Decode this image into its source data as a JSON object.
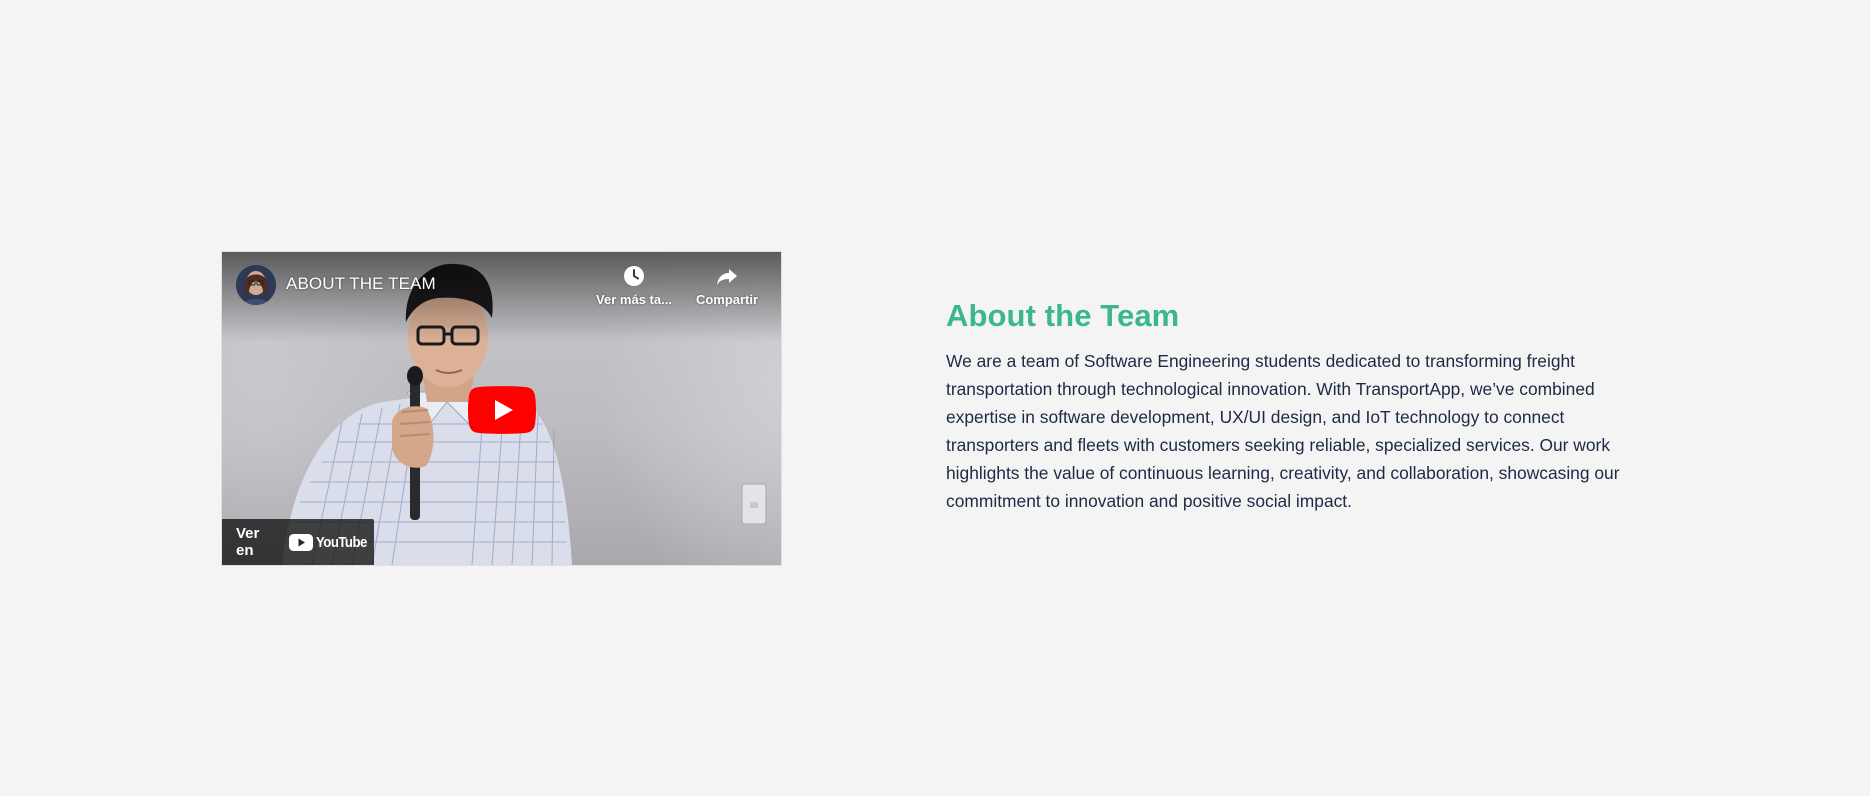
{
  "video": {
    "title": "ABOUT THE TEAM",
    "watch_later_label": "Ver más ta...",
    "share_label": "Compartir",
    "watch_on_label": "Ver en",
    "youtube_wordmark": "YouTube",
    "play_button_color": "#ff0000"
  },
  "about": {
    "heading": "About the Team",
    "description": "We are a team of Software Engineering students dedicated to transforming freight transportation through technological innovation. With TransportApp, we’ve combined expertise in software development, UX/UI design, and IoT technology to connect transporters and fleets with customers seeking reliable, specialized services. Our work highlights the value of continuous learning, creativity, and collaboration, showcasing our commitment to innovation and positive social impact.",
    "heading_color": "#3cb68c",
    "text_color": "#1d2a44"
  },
  "icons": {
    "watch_later": "clock-icon",
    "share": "share-arrow-icon",
    "play": "play-icon",
    "youtube": "youtube-logo-icon"
  },
  "colors": {
    "page_background": "#f4f4f4"
  }
}
